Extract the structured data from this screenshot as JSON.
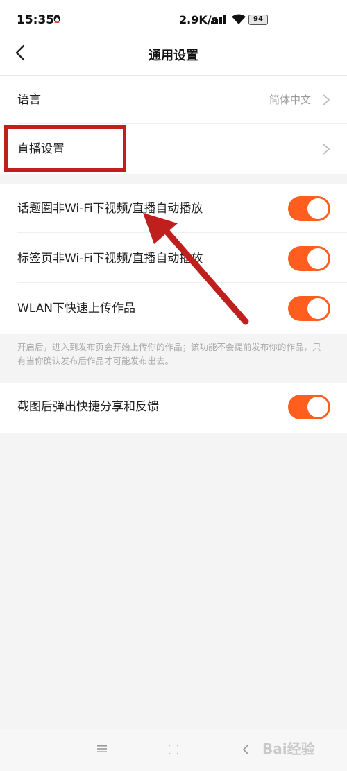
{
  "status": {
    "time": "15:35",
    "speed": "2.9K/s",
    "battery": "94"
  },
  "header": {
    "title": "通用设置"
  },
  "sections": {
    "general": {
      "language": {
        "label": "语言",
        "value": "简体中文"
      },
      "live": {
        "label": "直播设置"
      }
    },
    "autoplay": {
      "topic_circle": {
        "label": "话题圈非Wi-Fi下视频/直播自动播放",
        "on": true
      },
      "tag_page": {
        "label": "标签页非Wi-Fi下视频/直播自动播放",
        "on": true
      },
      "wlan_upload": {
        "label": "WLAN下快速上传作品",
        "on": true
      }
    },
    "upload_note": "开启后，进入到发布页会开始上传你的作品；该功能不会提前发布你的作品，只有当你确认发布后作品才可能发布出去。",
    "screenshot": {
      "label": "截图后弹出快捷分享和反馈",
      "on": true
    }
  },
  "colors": {
    "accent": "#ff5e1f",
    "annotation": "#c0201d"
  },
  "icons": [
    "qq-penguin-icon",
    "signal-icon",
    "wifi-icon",
    "battery-icon",
    "back-arrow-icon",
    "chevron-right-icon",
    "menu-icon",
    "home-icon",
    "nav-back-icon"
  ],
  "watermark": "Bai经验"
}
